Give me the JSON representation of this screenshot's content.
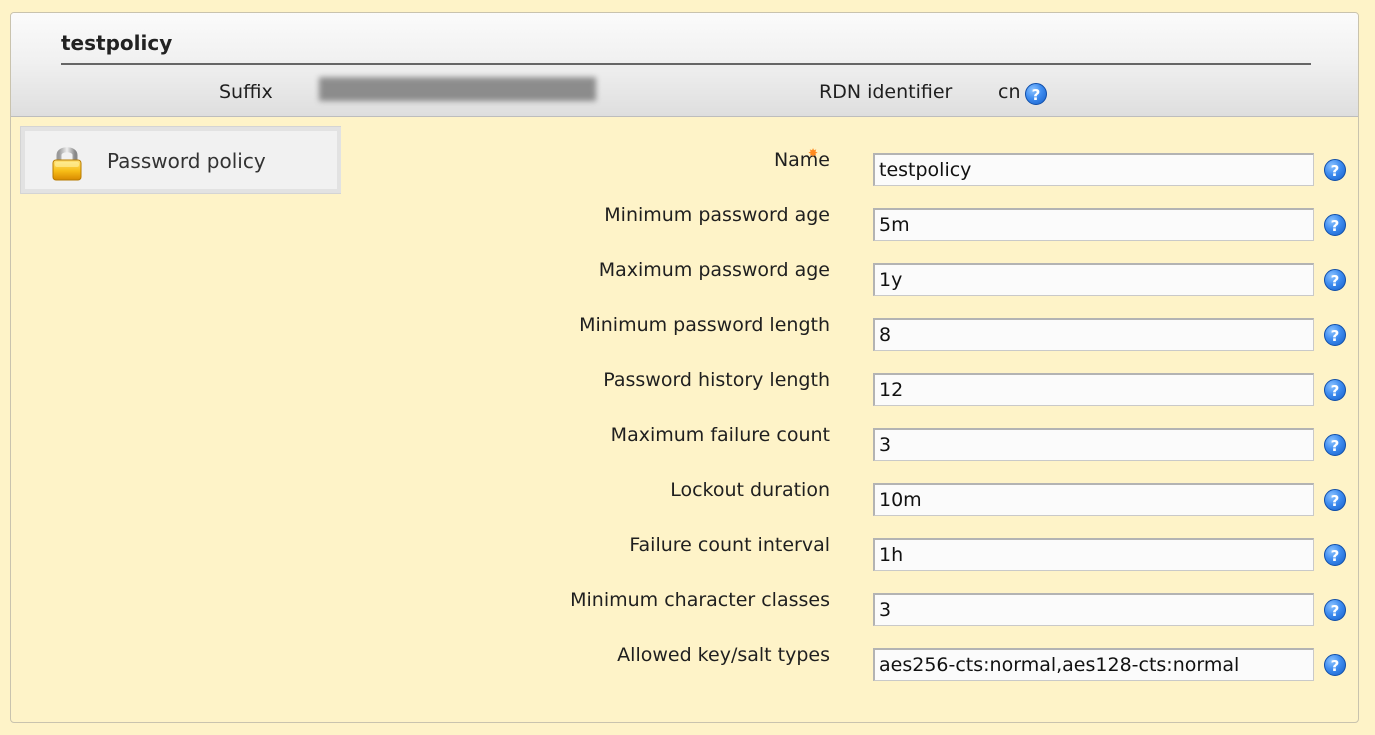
{
  "header": {
    "title": "testpolicy",
    "suffix_label": "Suffix",
    "rdn_label": "RDN identifier",
    "rdn_value": "cn",
    "help_glyph": "?"
  },
  "sidebar": {
    "items": [
      {
        "label": "Password policy",
        "icon": "lock-icon"
      }
    ]
  },
  "form": {
    "fields": [
      {
        "label": "Name",
        "value": "testpolicy",
        "required": true
      },
      {
        "label": "Minimum password age",
        "value": "5m"
      },
      {
        "label": "Maximum password age",
        "value": "1y"
      },
      {
        "label": "Minimum password length",
        "value": "8"
      },
      {
        "label": "Password history length",
        "value": "12"
      },
      {
        "label": "Maximum failure count",
        "value": "3"
      },
      {
        "label": "Lockout duration",
        "value": "10m"
      },
      {
        "label": "Failure count interval",
        "value": "1h"
      },
      {
        "label": "Minimum character classes",
        "value": "3"
      },
      {
        "label": "Allowed key/salt types",
        "value": "aes256-cts:normal,aes128-cts:normal"
      }
    ]
  },
  "colors": {
    "background": "#fef3c8",
    "help_icon": "#3e8cf0",
    "required": "#ff8a1f"
  }
}
